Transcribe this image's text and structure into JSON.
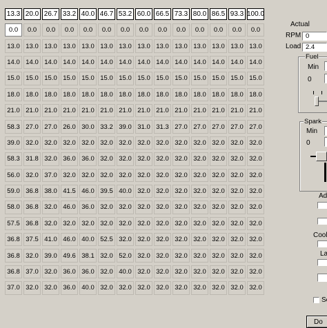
{
  "table": {
    "header": [
      "13.3",
      "20.0",
      "26.7",
      "33.2",
      "40.0",
      "46.7",
      "53.2",
      "60.0",
      "66.5",
      "73.3",
      "80.0",
      "86.5",
      "93.3",
      "100.0"
    ],
    "rows": [
      [
        "0.0",
        "0.0",
        "0.0",
        "0.0",
        "0.0",
        "0.0",
        "0.0",
        "0.0",
        "0.0",
        "0.0",
        "0.0",
        "0.0",
        "0.0",
        "0.0"
      ],
      [
        "13.0",
        "13.0",
        "13.0",
        "13.0",
        "13.0",
        "13.0",
        "13.0",
        "13.0",
        "13.0",
        "13.0",
        "13.0",
        "13.0",
        "13.0",
        "13.0"
      ],
      [
        "14.0",
        "14.0",
        "14.0",
        "14.0",
        "14.0",
        "14.0",
        "14.0",
        "14.0",
        "14.0",
        "14.0",
        "14.0",
        "14.0",
        "14.0",
        "14.0"
      ],
      [
        "15.0",
        "15.0",
        "15.0",
        "15.0",
        "15.0",
        "15.0",
        "15.0",
        "15.0",
        "15.0",
        "15.0",
        "15.0",
        "15.0",
        "15.0",
        "15.0"
      ],
      [
        "18.0",
        "18.0",
        "18.0",
        "18.0",
        "18.0",
        "18.0",
        "18.0",
        "18.0",
        "18.0",
        "18.0",
        "18.0",
        "18.0",
        "18.0",
        "18.0"
      ],
      [
        "21.0",
        "21.0",
        "21.0",
        "21.0",
        "21.0",
        "21.0",
        "21.0",
        "21.0",
        "21.0",
        "21.0",
        "21.0",
        "21.0",
        "21.0",
        "21.0"
      ],
      [
        "58.3",
        "27.0",
        "27.0",
        "26.0",
        "30.0",
        "33.2",
        "39.0",
        "31.0",
        "31.3",
        "27.0",
        "27.0",
        "27.0",
        "27.0",
        "27.0"
      ],
      [
        "39.0",
        "32.0",
        "32.0",
        "32.0",
        "32.0",
        "32.0",
        "32.0",
        "32.0",
        "32.0",
        "32.0",
        "32.0",
        "32.0",
        "32.0",
        "32.0"
      ],
      [
        "58.3",
        "31.8",
        "32.0",
        "36.0",
        "36.0",
        "32.0",
        "32.0",
        "32.0",
        "32.0",
        "32.0",
        "32.0",
        "32.0",
        "32.0",
        "32.0"
      ],
      [
        "56.0",
        "32.0",
        "37.0",
        "32.0",
        "32.0",
        "32.0",
        "32.0",
        "32.0",
        "32.0",
        "32.0",
        "32.0",
        "32.0",
        "32.0",
        "32.0"
      ],
      [
        "59.0",
        "36.8",
        "38.0",
        "41.5",
        "46.0",
        "39.5",
        "40.0",
        "32.0",
        "32.0",
        "32.0",
        "32.0",
        "32.0",
        "32.0",
        "32.0"
      ],
      [
        "58.0",
        "36.8",
        "32.0",
        "46.0",
        "36.0",
        "32.0",
        "32.0",
        "32.0",
        "32.0",
        "32.0",
        "32.0",
        "32.0",
        "32.0",
        "32.0"
      ],
      [
        "57.5",
        "36.8",
        "32.0",
        "32.0",
        "32.0",
        "32.0",
        "32.0",
        "32.0",
        "32.0",
        "32.0",
        "32.0",
        "32.0",
        "32.0",
        "32.0"
      ],
      [
        "36.8",
        "37.5",
        "41.0",
        "46.0",
        "40.0",
        "52.5",
        "32.0",
        "32.0",
        "32.0",
        "32.0",
        "32.0",
        "32.0",
        "32.0",
        "32.0"
      ],
      [
        "36.8",
        "32.0",
        "39.0",
        "49.6",
        "38.1",
        "32.0",
        "52.0",
        "32.0",
        "32.0",
        "32.0",
        "32.0",
        "32.0",
        "32.0",
        "32.0"
      ],
      [
        "36.8",
        "37.0",
        "32.0",
        "36.0",
        "36.0",
        "32.0",
        "40.0",
        "32.0",
        "32.0",
        "32.0",
        "32.0",
        "32.0",
        "32.0",
        "32.0"
      ],
      [
        "37.0",
        "32.0",
        "32.0",
        "36.0",
        "40.0",
        "32.0",
        "32.0",
        "32.0",
        "32.0",
        "32.0",
        "32.0",
        "32.0",
        "32.0",
        "32.0"
      ]
    ]
  },
  "panel": {
    "actual_label": "Actual",
    "rpm_label": "RPM",
    "rpm_value": "0",
    "load_label": "Load",
    "load_value": "2.4",
    "fuel_title": "Fuel",
    "fuel_min_label": "Min",
    "fuel_min_value": "0",
    "spark_title": "Spark",
    "spark_min_label": "Min",
    "spark_min_value": "0",
    "adv_label": "Adv",
    "coolant_label": "Coola",
    "la_label": "La",
    "se_label": "Se",
    "done_label": "Do"
  }
}
